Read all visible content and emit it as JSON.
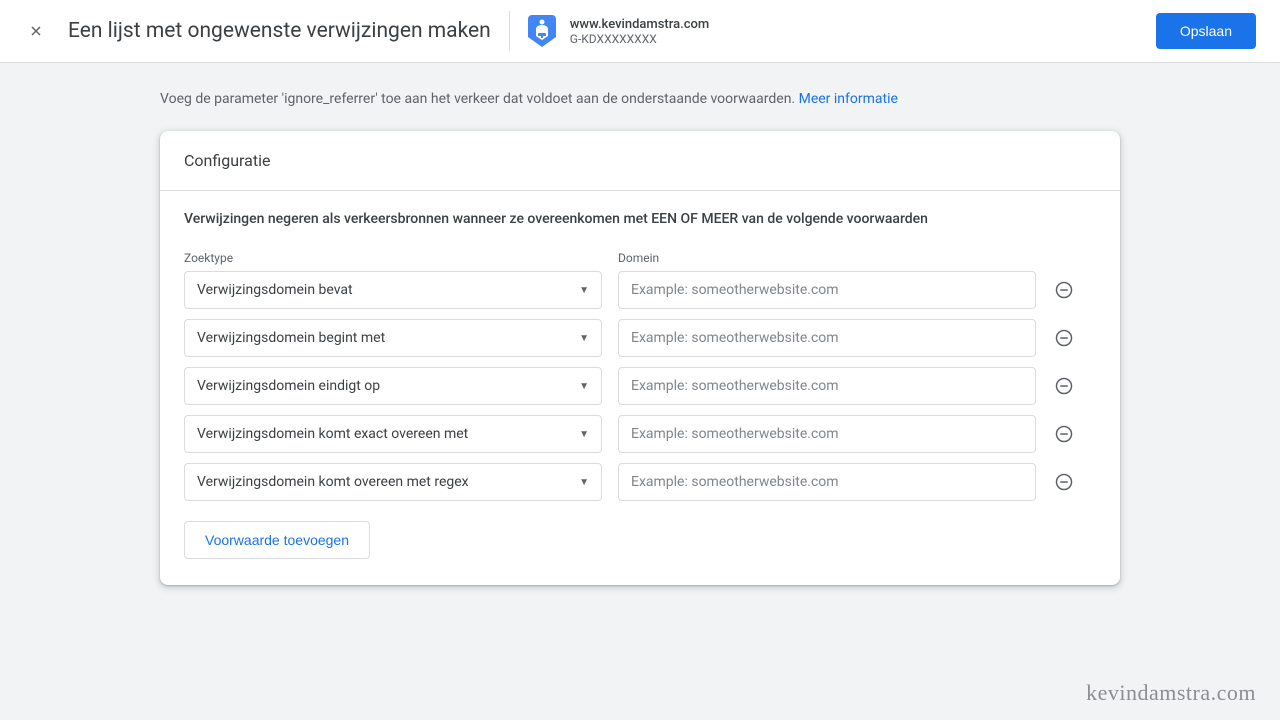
{
  "header": {
    "title": "Een lijst met ongewenste verwijzingen maken",
    "property_domain": "www.kevindamstra.com",
    "property_id": "G-KDXXXXXXXX",
    "save_label": "Opslaan"
  },
  "help": {
    "text": "Voeg de parameter 'ignore_referrer' toe aan het verkeer dat voldoet aan de onderstaande voorwaarden. ",
    "link": "Meer informatie"
  },
  "card": {
    "title": "Configuratie",
    "instruction": "Verwijzingen negeren als verkeersbronnen wanneer ze overeenkomen met EEN OF MEER van de volgende voorwaarden",
    "label_zoektype": "Zoektype",
    "label_domein": "Domein",
    "placeholder": "Example: someotherwebsite.com",
    "conditions": [
      {
        "match_type": "Verwijzingsdomein bevat",
        "value": ""
      },
      {
        "match_type": "Verwijzingsdomein begint met",
        "value": ""
      },
      {
        "match_type": "Verwijzingsdomein eindigt op",
        "value": ""
      },
      {
        "match_type": "Verwijzingsdomein komt exact overeen met",
        "value": ""
      },
      {
        "match_type": "Verwijzingsdomein komt overeen met regex",
        "value": ""
      }
    ],
    "add_label": "Voorwaarde toevoegen"
  },
  "watermark": "kevindamstra.com"
}
